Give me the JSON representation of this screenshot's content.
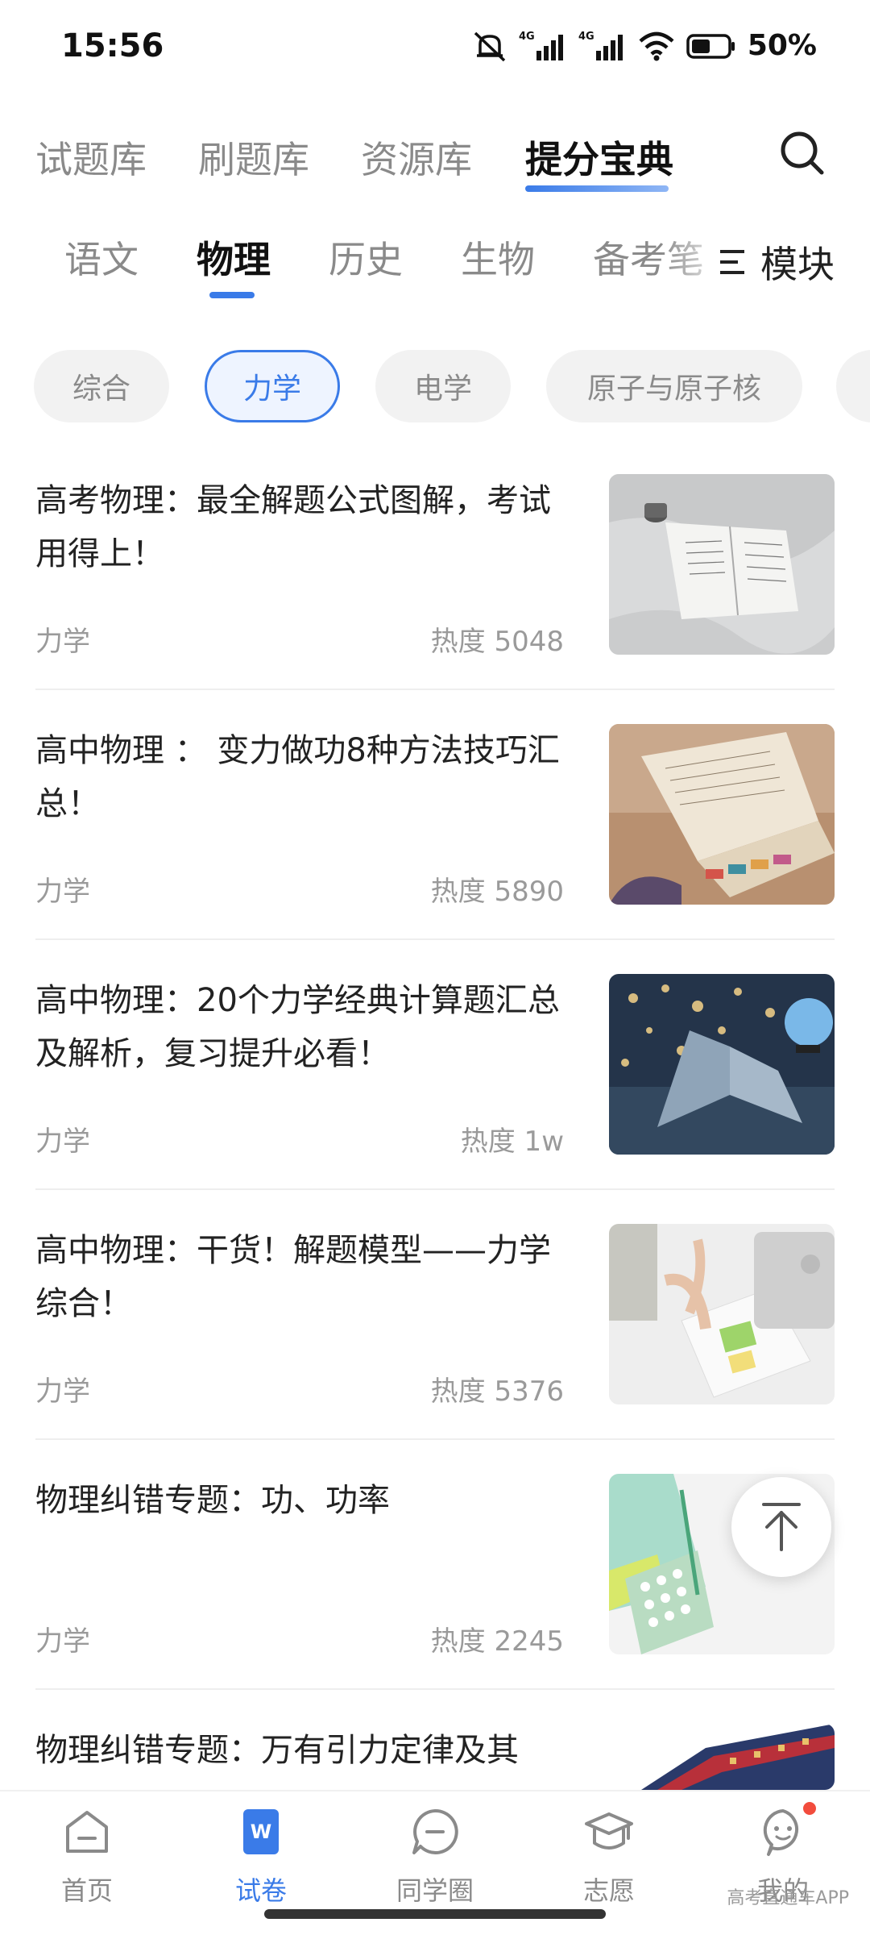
{
  "status_bar": {
    "time": "15:56",
    "battery": "50%",
    "icons": [
      "mute-icon",
      "signal-4g-icon",
      "signal-4g-icon",
      "wifi-icon",
      "battery-icon"
    ]
  },
  "top_tabs": [
    {
      "label": "试题库",
      "active": false
    },
    {
      "label": "刷题库",
      "active": false
    },
    {
      "label": "资源库",
      "active": false
    },
    {
      "label": "提分宝典",
      "active": true
    }
  ],
  "subject_tabs": [
    {
      "label": "语文",
      "active": false
    },
    {
      "label": "物理",
      "active": true
    },
    {
      "label": "历史",
      "active": false
    },
    {
      "label": "生物",
      "active": false
    },
    {
      "label": "备考笔",
      "active": false
    }
  ],
  "module_button": {
    "label": "模块",
    "icon": "menu-list-icon"
  },
  "chips": [
    {
      "label": "综合",
      "active": false
    },
    {
      "label": "力学",
      "active": true
    },
    {
      "label": "电学",
      "active": false
    },
    {
      "label": "原子与原子核",
      "active": false
    }
  ],
  "articles": [
    {
      "title": "高考物理：最全解题公式图解，考试用得上！",
      "tag": "力学",
      "heat": "热度 5048"
    },
    {
      "title": "高中物理 ： 变力做功8种方法技巧汇总！",
      "tag": "力学",
      "heat": "热度 5890"
    },
    {
      "title": "高中物理：20个力学经典计算题汇总及解析，复习提升必看！",
      "tag": "力学",
      "heat": "热度 1w"
    },
    {
      "title": "高中物理：干货！解题模型——力学综合！",
      "tag": "力学",
      "heat": "热度 5376"
    },
    {
      "title": "物理纠错专题：功、功率",
      "tag": "力学",
      "heat": "热度 2245"
    },
    {
      "title": "物理纠错专题：万有引力定律及其",
      "tag": "",
      "heat": ""
    }
  ],
  "bottom_nav": [
    {
      "label": "首页",
      "icon": "home-icon",
      "active": false
    },
    {
      "label": "试卷",
      "icon": "paper-icon",
      "active": true
    },
    {
      "label": "同学圈",
      "icon": "chat-circle-icon",
      "active": false
    },
    {
      "label": "志愿",
      "icon": "graduation-cap-icon",
      "active": false
    },
    {
      "label": "我的",
      "icon": "profile-icon",
      "active": false
    }
  ],
  "watermark": "高考直通车APP",
  "colors": {
    "accent": "#3a7be8",
    "muted": "#8a8a8a",
    "notification": "#f24c3d"
  }
}
